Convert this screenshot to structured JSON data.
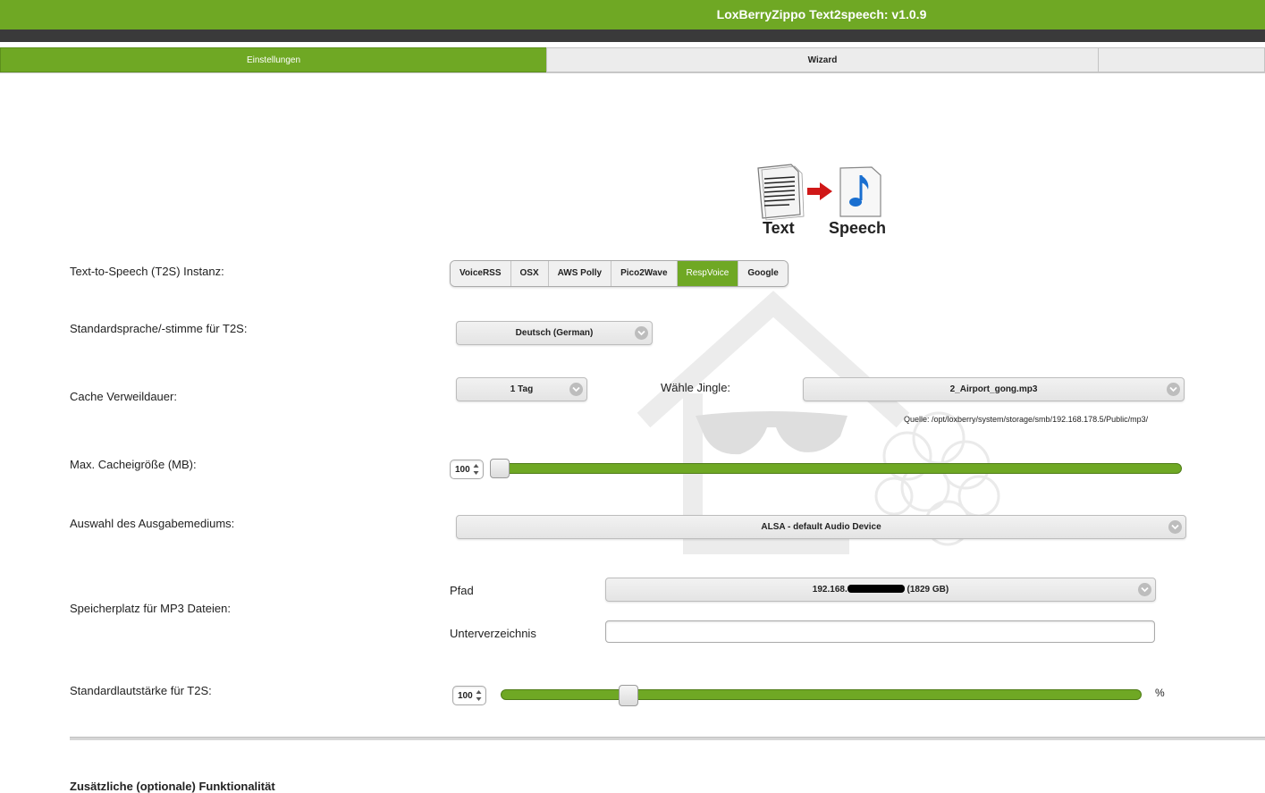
{
  "app": {
    "title": "LoxBerryZippo Text2speech: v1.0.9"
  },
  "nav": {
    "tabs": [
      {
        "label": "Einstellungen",
        "active": true
      },
      {
        "label": "Wizard",
        "active": false
      },
      {
        "label": "",
        "active": false
      }
    ]
  },
  "logo": {
    "text_label": "Text",
    "speech_label": "Speech"
  },
  "t2s": {
    "label": "Text-to-Speech (T2S) Instanz:",
    "options": [
      "VoiceRSS",
      "OSX",
      "AWS Polly",
      "Pico2Wave",
      "RespVoice",
      "Google"
    ],
    "selected": "RespVoice"
  },
  "language": {
    "label": "Standardsprache/-stimme für T2S:",
    "value": "Deutsch (German)"
  },
  "cache": {
    "label": "Cache Verweildauer:",
    "value": "1 Tag",
    "jingle_label": "Wähle Jingle:",
    "jingle_value": "2_Airport_gong.mp3",
    "source": "Quelle: /opt/loxberry/system/storage/smb/192.168.178.5/Public/mp3/"
  },
  "cachesize": {
    "label": "Max. Cacheigröße (MB):",
    "value": "100",
    "slider_fraction": 0.0
  },
  "output": {
    "label": "Auswahl des Ausgabemediums:",
    "value": "ALSA - default Audio Device"
  },
  "storage": {
    "label": "Speicherplatz für MP3 Dateien:",
    "path_label": "Pfad",
    "path_prefix": "192.168.",
    "path_suffix": "(1829 GB)",
    "subdir_label": "Unterverzeichnis",
    "subdir_value": ""
  },
  "volume": {
    "label": "Standardlautstärke für T2S:",
    "value": "100",
    "unit": "%",
    "slider_fraction": 0.2
  },
  "bottom": {
    "heading": "Zusätzliche (optionale) Funktionalität"
  },
  "colors": {
    "accent": "#6fa824",
    "dark": "#3a3a3a"
  }
}
